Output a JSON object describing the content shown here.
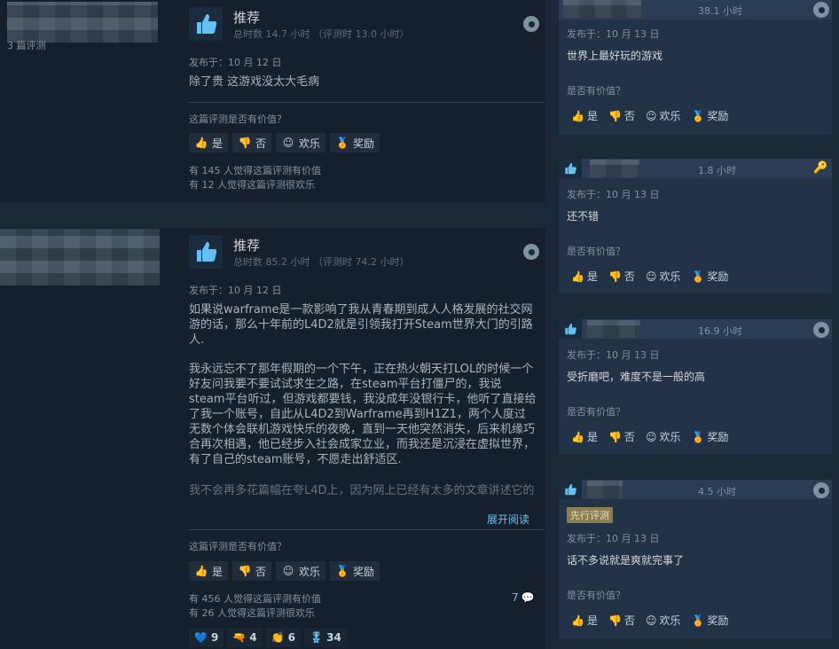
{
  "colors": {
    "bg": "#1b2838",
    "link": "#66c0f4",
    "badge": "#8c7e53"
  },
  "review1": {
    "title": "推荐",
    "hours": "总时数 14.7 小时 （评测时 13.0 小时）",
    "posted": "发布于：10 月 12 日",
    "body": "除了贵 这游戏没太大毛病",
    "helpful_q": "这篇评测是否有价值？",
    "yes": "是",
    "no": "否",
    "funny": "欢乐",
    "award": "奖励",
    "stat_helpful": "有 145 人觉得这篇评测有价值",
    "stat_funny": "有 12 人觉得这篇评测很欢乐",
    "author_reviews": "3 篇评测"
  },
  "review2": {
    "title": "推荐",
    "hours": "总时数 85.2 小时 （评测时 74.2 小时）",
    "posted": "发布于：10 月 12 日",
    "para1": "如果说warframe是一款影响了我从青春期到成人人格发展的社交网游的话，那么十年前的L4D2就是引领我打开Steam世界大门的引路人.",
    "para2": "我永远忘不了那年假期的一个下午，正在热火朝天打LOL的时候一个好友问我要不要试试求生之路，在steam平台打僵尸的，我说steam平台听过，但游戏都要钱，我没成年没银行卡，他听了直接给了我一个账号，自此从L4D2到Warframe再到H1Z1，两个人度过无数个体会联机游戏快乐的夜晚，直到一天他突然消失，后来机缘巧合再次相遇，他已经步入社会成家立业，而我还是沉浸在虚拟世界，有了自己的steam账号，不愿走出舒适区.",
    "para3": "我不会再多花篇幅在夸L4D上，因为网上已经有太多的文章讲述它的",
    "expand": "展开阅读",
    "helpful_q": "这篇评测是否有价值？",
    "yes": "是",
    "no": "否",
    "funny": "欢乐",
    "award": "奖励",
    "stat_helpful": "有 456 人觉得这篇评测有价值",
    "stat_funny": "有 26 人觉得这篇评测很欢乐",
    "comments": "7",
    "awards": [
      "9",
      "4",
      "6",
      "34"
    ]
  },
  "right": [
    {
      "hours": "38.1 小时",
      "posted": "发布于：10 月 13 日",
      "text": "世界上最好玩的游戏",
      "q": "是否有价值？",
      "yes": "是",
      "no": "否",
      "funny": "欢乐",
      "award": "奖励"
    },
    {
      "hours": "1.8 小时",
      "posted": "发布于：10 月 13 日",
      "text": "还不错",
      "q": "是否有价值？",
      "yes": "是",
      "no": "否",
      "funny": "欢乐",
      "award": "奖励"
    },
    {
      "hours": "16.9 小时",
      "posted": "发布于：10 月 13 日",
      "text": "受折磨吧，难度不是一般的高",
      "q": "是否有价值？",
      "yes": "是",
      "no": "否",
      "funny": "欢乐",
      "award": "奖励"
    },
    {
      "hours": "4.5 小时",
      "badge": "先行评测",
      "posted": "发布于：10 月 13 日",
      "text": "话不多说就是爽就完事了",
      "q": "是否有价值？",
      "yes": "是",
      "no": "否",
      "funny": "欢乐",
      "award": "奖励"
    }
  ]
}
